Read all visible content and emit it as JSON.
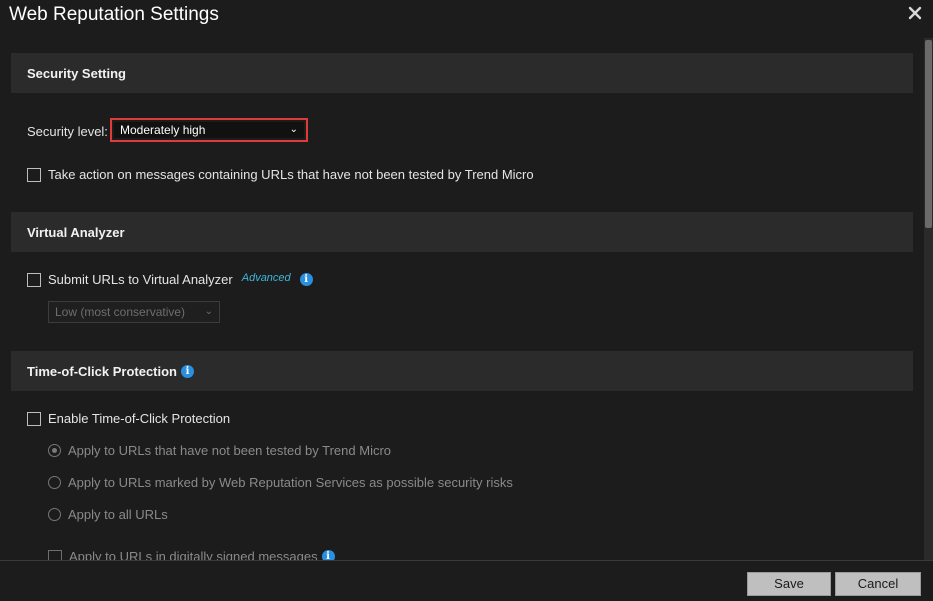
{
  "dialog": {
    "title": "Web Reputation Settings",
    "close_icon": "close-icon"
  },
  "security_setting": {
    "header": "Security Setting",
    "level_label": "Security level:",
    "level_value": "Moderately high",
    "untested_label": "Take action on messages containing URLs that have not been tested by Trend Micro"
  },
  "virtual_analyzer": {
    "header": "Virtual Analyzer",
    "submit_label": "Submit URLs to Virtual Analyzer",
    "advanced_badge": "Advanced",
    "level_value": "Low (most conservative)"
  },
  "toc": {
    "header": "Time-of-Click Protection",
    "enable_label": "Enable Time-of-Click Protection",
    "radio_untested": "Apply to URLs that have not been tested by Trend Micro",
    "radio_marked": "Apply to URLs marked by Web Reputation Services as possible security risks",
    "radio_all": "Apply to all URLs",
    "signed_label": "Apply to URLs in digitally signed messages"
  },
  "footer": {
    "save_label": "Save",
    "cancel_label": "Cancel"
  },
  "colors": {
    "highlight": "#e03b3b",
    "info": "#2b8fe0",
    "advanced": "#3fb6d8"
  }
}
